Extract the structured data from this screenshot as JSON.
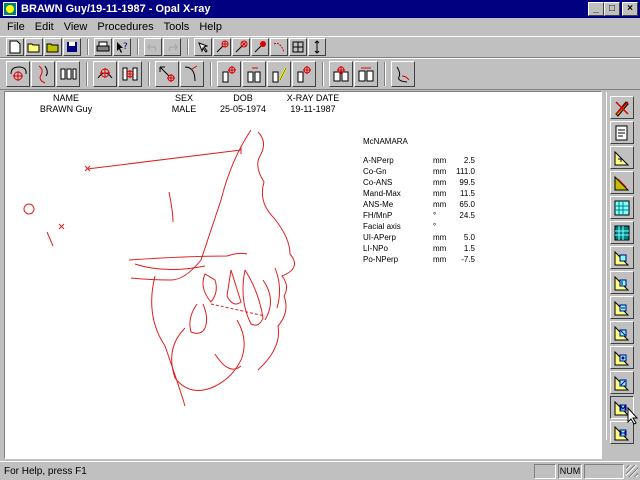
{
  "window": {
    "title": "BRAWN Guy/19-11-1987 - Opal X-ray",
    "controls": {
      "minimize": "_",
      "maximize": "□",
      "close": "×"
    }
  },
  "menu": [
    "File",
    "Edit",
    "View",
    "Procedures",
    "Tools",
    "Help"
  ],
  "patient": {
    "headers": {
      "name": "NAME",
      "sex": "SEX",
      "dob": "DOB",
      "xray": "X-RAY DATE"
    },
    "values": {
      "name": "BRAWN Guy",
      "sex": "MALE",
      "dob": "25-05-1974",
      "xray": "19-11-1987"
    }
  },
  "analysis": {
    "title": "McNAMARA",
    "rows": [
      {
        "name": "A-NPerp",
        "unit": "mm",
        "value": "2.5"
      },
      {
        "name": "Co-Gn",
        "unit": "mm",
        "value": "111.0"
      },
      {
        "name": "Co-ANS",
        "unit": "mm",
        "value": "99.5"
      },
      {
        "name": "Mand-Max",
        "unit": "mm",
        "value": "11.5"
      },
      {
        "name": "ANS-Me",
        "unit": "mm",
        "value": "65.0"
      },
      {
        "name": "FH/MnP",
        "unit": "°",
        "value": "24.5"
      },
      {
        "name": "Facial axis",
        "unit": "°",
        "value": ""
      },
      {
        "name": "UI-APerp",
        "unit": "mm",
        "value": "5.0"
      },
      {
        "name": "LI-NPo",
        "unit": "mm",
        "value": "1.5"
      },
      {
        "name": "Po-NPerp",
        "unit": "mm",
        "value": "-7.5"
      }
    ]
  },
  "status": {
    "text": "For Help, press F1",
    "num": "NUM"
  },
  "colors": {
    "title_bg": "#000080",
    "tracing": "#e02020",
    "face": "#c0c0c0"
  },
  "icons": {
    "toolbar1": [
      "new-file-icon",
      "open-folder-icon",
      "open-folder-alt-icon",
      "save-icon",
      "print-icon",
      "help-pointer-icon",
      "undo-icon",
      "redo-icon",
      "select-arrow-icon",
      "landmark-plus-icon",
      "landmark-plus-alt-icon",
      "landmark-move-icon",
      "curve-icon",
      "grid-icon",
      "vertical-measure-icon"
    ],
    "toolbar2": [
      "skull-target-icon",
      "profile-face-icon",
      "teeth-icon",
      "upper-jaw-target-icon",
      "teeth-target-icon",
      "arrow-target-icon",
      "arrow-curve-icon",
      "tooth-target-a-icon",
      "tooth-target-b-icon",
      "tooth-target-c-icon",
      "tooth-target-d-icon",
      "molar-target-icon",
      "molar-icon",
      "chin-profile-icon"
    ],
    "sidebar": [
      "delete-tracing-icon",
      "document-icon",
      "triangle-measure-icon",
      "triangle-measure-alt-icon",
      "grid-measure-icon",
      "grid-measure-alt-icon",
      "analysis-a-icon",
      "analysis-b-icon",
      "analysis-c-icon",
      "analysis-d-icon",
      "analysis-e-icon",
      "analysis-f-icon",
      "analysis-mcnamara-icon",
      "analysis-h-icon"
    ]
  }
}
